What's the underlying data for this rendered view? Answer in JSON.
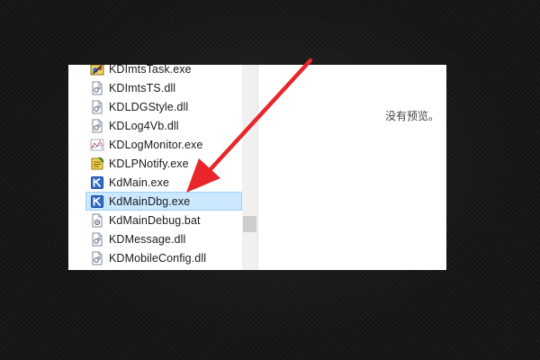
{
  "file_list": {
    "items": [
      {
        "name": "KDImtsTask.exe",
        "icon": "gear-app-icon",
        "selected": false
      },
      {
        "name": "KDImtsTS.dll",
        "icon": "dll-file-icon",
        "selected": false
      },
      {
        "name": "KDLDGStyle.dll",
        "icon": "dll-file-icon",
        "selected": false
      },
      {
        "name": "KDLog4Vb.dll",
        "icon": "dll-file-icon",
        "selected": false
      },
      {
        "name": "KDLogMonitor.exe",
        "icon": "monitor-app-icon",
        "selected": false
      },
      {
        "name": "KDLPNotify.exe",
        "icon": "notify-app-icon",
        "selected": false
      },
      {
        "name": "KdMain.exe",
        "icon": "kd-app-icon",
        "selected": false
      },
      {
        "name": "KdMainDbg.exe",
        "icon": "kd-app-icon",
        "selected": true
      },
      {
        "name": "KdMainDebug.bat",
        "icon": "batch-file-icon",
        "selected": false
      },
      {
        "name": "KDMessage.dll",
        "icon": "dll-file-icon",
        "selected": false
      },
      {
        "name": "KDMobileConfig.dll",
        "icon": "dll-file-icon",
        "selected": false
      }
    ]
  },
  "preview": {
    "message": "没有预览。"
  },
  "colors": {
    "selection_bg": "#cce8ff",
    "selection_border": "#99d1ff",
    "arrow": "#e8262b",
    "kd_icon": "#1e4f9c"
  }
}
